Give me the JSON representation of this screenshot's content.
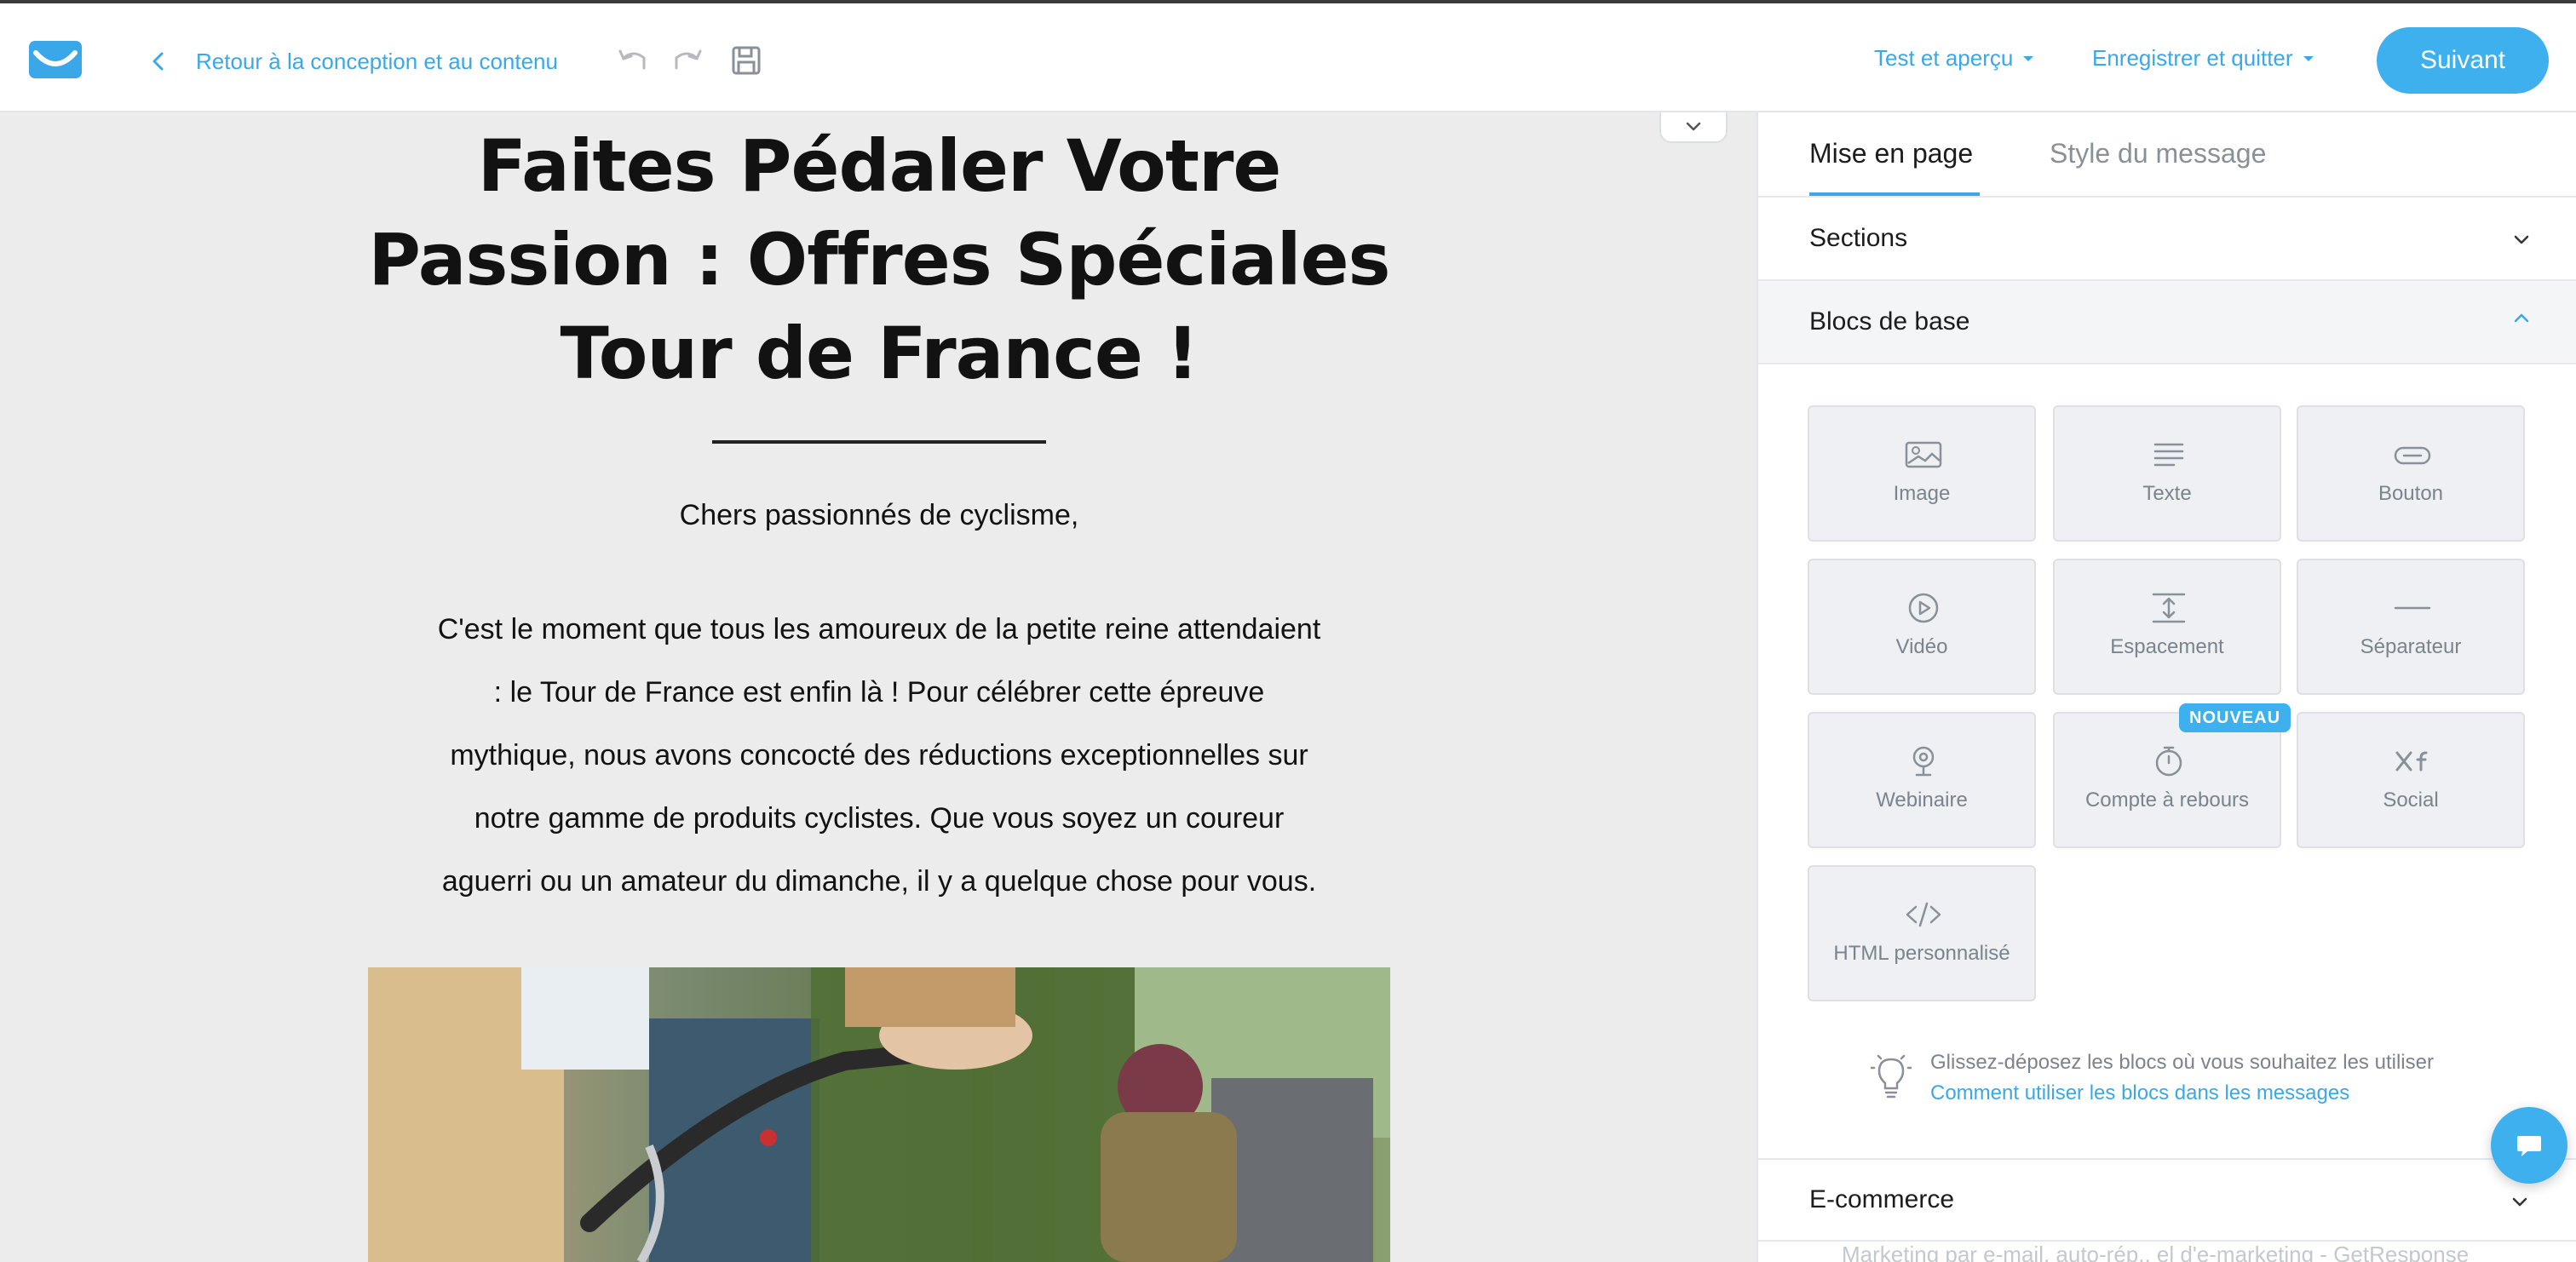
{
  "colors": {
    "accent": "#3aa8e8",
    "button": "#3fb0ee",
    "panel_bg": "#ffffff",
    "canvas_bg": "#ececec",
    "block_bg": "#eef0f3"
  },
  "topbar": {
    "back_label": "Retour à la conception et au contenu",
    "icons": [
      "undo-icon",
      "redo-icon",
      "save-icon"
    ],
    "test_label": "Test et aperçu",
    "save_quit_label": "Enregistrer et quitter",
    "next_label": "Suivant"
  },
  "email": {
    "headline": [
      "Faites Pédaler Votre",
      "Passion : Offres Spéciales",
      "Tour de France !"
    ],
    "greeting": "Chers passionnés de cyclisme,",
    "body_lines": [
      "C'est le moment que tous les amoureux de la petite reine attendaient",
      ": le Tour de France est enfin là ! Pour célébrer cette épreuve",
      "mythique, nous avons concocté des réductions exceptionnelles sur",
      "notre gamme de produits cyclistes. Que vous soyez un coureur",
      "aguerri ou un amateur du dimanche, il y a quelque chose pour vous."
    ]
  },
  "panel": {
    "tabs": {
      "layout": "Mise en page",
      "style": "Style du message"
    },
    "sections_label": "Sections",
    "basic_blocks_label": "Blocs de base",
    "blocks": [
      {
        "label": "Image",
        "icon": "image-icon"
      },
      {
        "label": "Texte",
        "icon": "text-icon"
      },
      {
        "label": "Bouton",
        "icon": "button-icon"
      },
      {
        "label": "Vidéo",
        "icon": "video-icon"
      },
      {
        "label": "Espacement",
        "icon": "spacing-icon"
      },
      {
        "label": "Séparateur",
        "icon": "divider-icon"
      },
      {
        "label": "Webinaire",
        "icon": "webinar-icon"
      },
      {
        "label": "Compte à rebours",
        "icon": "timer-icon"
      },
      {
        "label": "Social",
        "icon": "social-icon"
      },
      {
        "label": "HTML personnalisé",
        "icon": "code-icon"
      }
    ],
    "new_badge": "NOUVEAU",
    "tip_text": "Glissez-déposez les blocs où vous souhaitez les utiliser",
    "tip_link": "Comment utiliser les blocs dans les messages",
    "ecommerce_label": "E-commerce",
    "footer_ghost": "Marketing par e-mail, auto-rép., el d'e-marketing - GetResponse"
  }
}
